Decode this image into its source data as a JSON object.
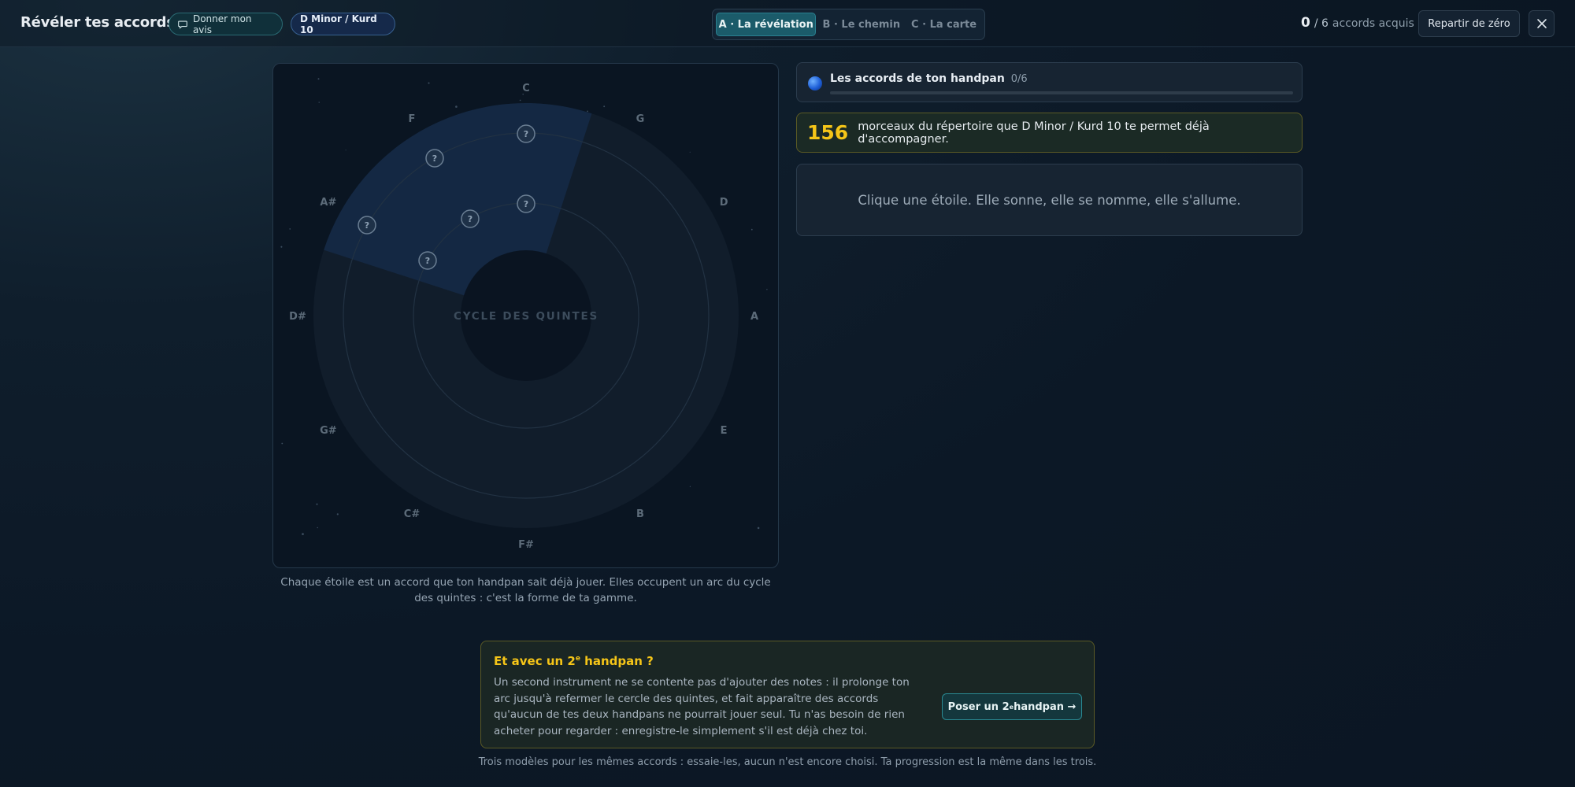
{
  "header": {
    "title": "Révéler tes accords",
    "feedback_label": "Donner mon avis",
    "scale_label": "D Minor / Kurd 10",
    "tabs": [
      {
        "label": "A · La révélation",
        "active": true
      },
      {
        "label": "B · Le chemin",
        "active": false
      },
      {
        "label": "C · La carte",
        "active": false
      }
    ],
    "acquired_count": "0",
    "acquired_total": "/ 6",
    "acquired_label": "accords acquis",
    "reset_label": "Repartir de zéro",
    "close_icon": "close-icon"
  },
  "circle": {
    "center_label": "CYCLE DES QUINTES",
    "notes": [
      "C",
      "G",
      "D",
      "A",
      "E",
      "B",
      "F#",
      "C#",
      "G#",
      "D#",
      "A#",
      "F"
    ],
    "star_marker": "?",
    "star_count": 6,
    "caption": "Chaque étoile est un accord que ton handpan sait déjà jouer. Elles occupent un arc du cycle des quintes : c'est la forme de ta gamme."
  },
  "chords_card": {
    "title": "Les accords de ton handpan",
    "count": "0/6",
    "progress": 0
  },
  "repertoire_card": {
    "number": "156",
    "text": "morceaux du répertoire que D Minor / Kurd 10 te permet déjà d'accompagner."
  },
  "hint_card": {
    "text": "Clique une étoile. Elle sonne, elle se nomme, elle s'allume."
  },
  "second_handpan": {
    "title_pre": "Et avec un 2",
    "title_sup": "e",
    "title_post": " handpan ?",
    "text": "Un second instrument ne se contente pas d'ajouter des notes : il prolonge ton arc jusqu'à refermer le cercle des quintes, et fait apparaître des accords qu'aucun de tes deux handpans ne pourrait jouer seul. Tu n'as besoin de rien acheter pour regarder : enregistre-le simplement s'il est déjà chez toi.",
    "button_pre": "Poser un 2",
    "button_sup": "e",
    "button_post": " handpan →"
  },
  "footer": {
    "note": "Trois modèles pour les mêmes accords : essaie-les, aucun n'est encore choisi. Ta progression est la même dans les trois."
  },
  "colors": {
    "accent_teal": "#1b5b6a",
    "highlight_yellow": "#f5c518",
    "background": "#0c1826"
  }
}
